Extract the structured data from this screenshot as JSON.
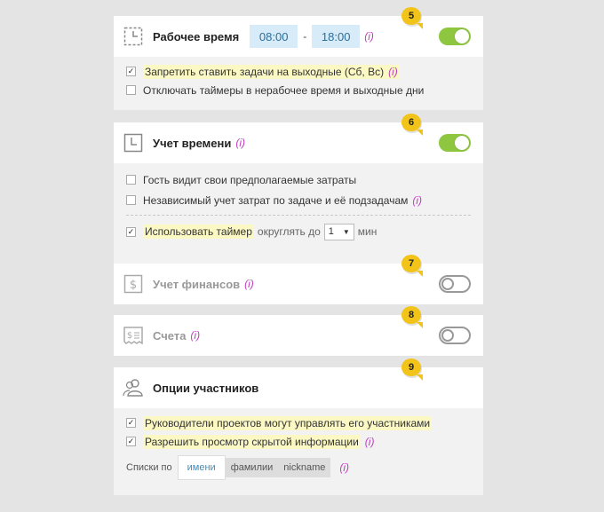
{
  "work_time": {
    "badge": "5",
    "title": "Рабочее время",
    "start": "08:00",
    "separator": "-",
    "end": "18:00",
    "info": "(i)",
    "enabled": true,
    "options": [
      {
        "label": "Запретить ставить задачи на выходные (Сб, Вс)",
        "checked": true,
        "info": "(i)"
      },
      {
        "label": "Отключать таймеры в нерабочее время и выходные дни",
        "checked": false,
        "info": ""
      }
    ]
  },
  "time_tracking": {
    "badge": "6",
    "title": "Учет времени",
    "info": "(i)",
    "enabled": true,
    "options": [
      {
        "label": "Гость видит свои предполагаемые затраты",
        "checked": false,
        "info": ""
      },
      {
        "label": "Независимый учет затрат по задаче и её подзадачам",
        "checked": false,
        "info": "(i)"
      }
    ],
    "timer": {
      "label": "Использовать таймер",
      "checked": true,
      "round_label": "округлять до",
      "round_value": "1",
      "unit": "мин"
    }
  },
  "finance": {
    "badge": "7",
    "title": "Учет финансов",
    "info": "(i)",
    "enabled": false
  },
  "invoices": {
    "badge": "8",
    "title": "Счета",
    "info": "(i)",
    "enabled": false
  },
  "members": {
    "badge": "9",
    "title": "Опции участников",
    "options": [
      {
        "label": "Руководители проектов могут управлять его участниками",
        "checked": true,
        "info": ""
      },
      {
        "label": "Разрешить просмотр скрытой информации",
        "checked": true,
        "info": "(i)"
      }
    ],
    "list_by_label": "Списки по",
    "list_by_options": [
      "имени",
      "фамилии",
      "nickname"
    ],
    "list_by_selected": "имени",
    "info": "(i)"
  },
  "icons": {
    "work_time": "clock-corner-icon",
    "time_tracking": "clock-icon",
    "finance": "dollar-icon",
    "invoices": "invoice-icon",
    "members": "users-icon",
    "checkmark": "✓",
    "dropdown": "▼"
  },
  "colors": {
    "toggle_on": "#8ec63f",
    "badge": "#f2c318",
    "time_bg": "#d7ebf8",
    "info": "#c040c0",
    "highlight": "#fbf8c4"
  }
}
